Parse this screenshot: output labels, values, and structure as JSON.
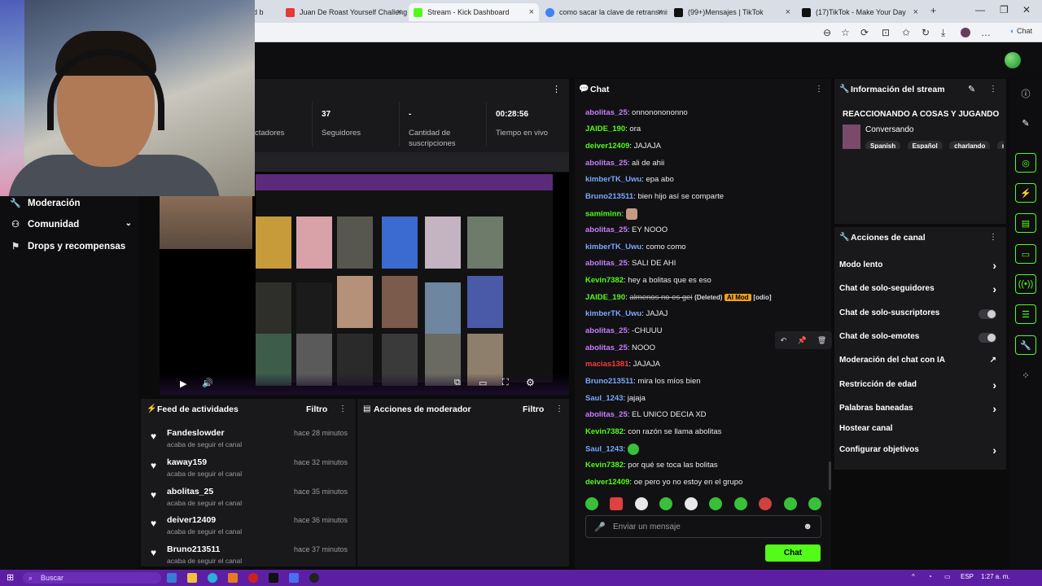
{
  "browser": {
    "tabs": [
      {
        "title": "d b",
        "active": false
      },
      {
        "title": "Juan De Roast Yourself Challenge",
        "active": false
      },
      {
        "title": "Stream - Kick Dashboard",
        "active": true
      },
      {
        "title": "como sacar la clave de retransmis",
        "active": false
      },
      {
        "title": "(99+)Mensajes | TikTok",
        "active": false
      },
      {
        "title": "(17)TikTok - Make Your Day",
        "active": false
      }
    ],
    "chat_label": "Chat"
  },
  "nav": {
    "items": [
      {
        "label": "Moderación",
        "icon": "wrench-icon"
      },
      {
        "label": "Comunidad",
        "icon": "community-icon"
      },
      {
        "label": "Drops y recompensas",
        "icon": "gift-icon"
      }
    ]
  },
  "stats": {
    "viewers_label": "ctadores",
    "followers_value": "37",
    "followers_label": "Seguidores",
    "subs_value": "-",
    "subs_label": "Cantidad de suscripciones",
    "live_value": "00:28:56",
    "live_label": "Tiempo en vivo"
  },
  "feed": {
    "title": "Feed de actividades",
    "filter": "Filtro",
    "items": [
      {
        "name": "Fandeslowder",
        "sub": "acaba de seguir el canal",
        "time": "hace 28 minutos"
      },
      {
        "name": "kaway159",
        "sub": "acaba de seguir el canal",
        "time": "hace 32 minutos"
      },
      {
        "name": "abolitas_25",
        "sub": "acaba de seguir el canal",
        "time": "hace 35 minutos"
      },
      {
        "name": "deiver12409",
        "sub": "acaba de seguir el canal",
        "time": "hace 36 minutos"
      },
      {
        "name": "Bruno213511",
        "sub": "acaba de seguir el canal",
        "time": "hace 37 minutos"
      }
    ]
  },
  "mod_actions": {
    "title": "Acciones de moderador",
    "filter": "Filtro"
  },
  "chat": {
    "title": "Chat",
    "messages": [
      {
        "user": "abolitas_25",
        "color": "#c77dff",
        "text": "onnononononno"
      },
      {
        "user": "JAIDE_190",
        "color": "#53fc18",
        "text": "ora"
      },
      {
        "user": "deiver12409",
        "color": "#53fc18",
        "text": "JAJAJA"
      },
      {
        "user": "abolitas_25",
        "color": "#c77dff",
        "text": "ali de ahii"
      },
      {
        "user": "kimberTK_Uwu",
        "color": "#7aa8ff",
        "text": "epa abo"
      },
      {
        "user": "Bruno213511",
        "color": "#7aa8ff",
        "text": "bien hijo así se comparte"
      },
      {
        "user": "samiminn",
        "color": "#53fc18",
        "text": ""
      },
      {
        "user": "abolitas_25",
        "color": "#c77dff",
        "text": "EY NOOO"
      },
      {
        "user": "kimberTK_Uwu",
        "color": "#7aa8ff",
        "text": "como como"
      },
      {
        "user": "abolitas_25",
        "color": "#c77dff",
        "text": "SALI DE AHI"
      },
      {
        "user": "Kevin7382",
        "color": "#53fc18",
        "text": "hey a bolitas que es eso"
      },
      {
        "user": "JAIDE_190",
        "color": "#53fc18",
        "text": "almenos no es gei"
      },
      {
        "user": "kimberTK_Uwu",
        "color": "#7aa8ff",
        "text": "JAJAJ"
      },
      {
        "user": "abolitas_25",
        "color": "#c77dff",
        "text": "-CHUUU"
      },
      {
        "user": "abolitas_25",
        "color": "#c77dff",
        "text": "NOOO"
      },
      {
        "user": "macias1381",
        "color": "#ff3b3b",
        "text": "JAJAJA"
      },
      {
        "user": "Bruno213511",
        "color": "#7aa8ff",
        "text": "mira los míos bien"
      },
      {
        "user": "Saul_1243",
        "color": "#7aa8ff",
        "text": "jajaja"
      },
      {
        "user": "abolitas_25",
        "color": "#c77dff",
        "text": "EL UNICO DECIA XD"
      },
      {
        "user": "Kevin7382",
        "color": "#53fc18",
        "text": "con razón se llama abolitas"
      },
      {
        "user": "Saul_1243",
        "color": "#7aa8ff",
        "text": ""
      },
      {
        "user": "Kevin7382",
        "color": "#53fc18",
        "text": "por qué se toca las bolitas"
      },
      {
        "user": "deiver12409",
        "color": "#53fc18",
        "text": "oe pero yo no estoy en el grupo"
      }
    ],
    "deleted_tag": "(Deleted)",
    "ai_tag": "AI Mod",
    "odio_tag": "[odio]",
    "input_placeholder": "Enviar un mensaje",
    "send_label": "Chat"
  },
  "stream_info": {
    "title": "Información del stream",
    "stream_title": "REACCIONANDO A COSAS Y JUGANDO",
    "category": "Conversando",
    "tags": [
      "Spanish",
      "Español",
      "charlando",
      "m"
    ]
  },
  "channel_actions": {
    "title": "Acciones de canal",
    "items": [
      {
        "label": "Modo lento",
        "control": "chevron"
      },
      {
        "label": "Chat de solo-seguidores",
        "control": "chevron"
      },
      {
        "label": "Chat de solo-suscriptores",
        "control": "toggle"
      },
      {
        "label": "Chat de solo-emotes",
        "control": "toggle"
      },
      {
        "label": "Moderación del chat con IA",
        "control": "external"
      },
      {
        "label": "Restricción de edad",
        "control": "chevron"
      },
      {
        "label": "Palabras baneadas",
        "control": "chevron"
      },
      {
        "label": "Hostear canal",
        "control": "none"
      },
      {
        "label": "Configurar objetivos",
        "control": "chevron"
      }
    ]
  },
  "taskbar": {
    "search_placeholder": "Buscar",
    "lang": "ESP",
    "time": "1:27 a. m."
  },
  "colors": {
    "accent": "#53fc18",
    "panel": "#19191c",
    "background": "#0b0b0c",
    "taskbar": "#5c1fa3"
  }
}
